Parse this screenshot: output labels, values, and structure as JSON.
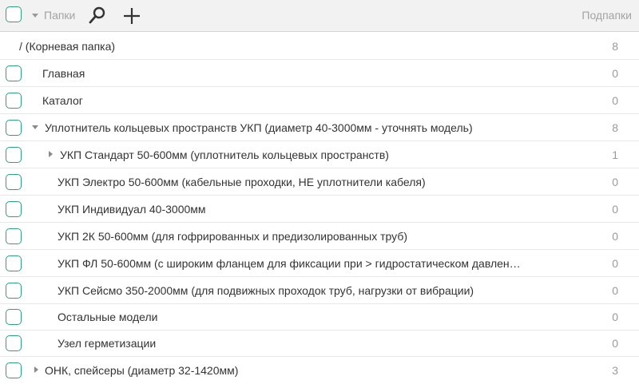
{
  "header": {
    "title": "Папки",
    "subfolders_label": "Подпапки",
    "icons": [
      "search-icon",
      "plus-icon"
    ]
  },
  "colors": {
    "accent": "#2ea37a",
    "header_bg": "#f2f2f2",
    "muted_text": "#a3a3a3"
  },
  "rows": [
    {
      "label": "/ (Корневая папка)",
      "count": "8"
    },
    {
      "label": "Главная",
      "count": "0"
    },
    {
      "label": "Каталог",
      "count": "0"
    },
    {
      "label": "Уплотнитель кольцевых пространств УКП (диаметр 40-3000мм - уточнять модель)",
      "count": "8"
    },
    {
      "label": "УКП Стандарт 50-600мм (уплотнитель кольцевых пространств)",
      "count": "1"
    },
    {
      "label": "УКП Электро 50-600мм (кабельные проходки, НЕ уплотнители кабеля)",
      "count": "0"
    },
    {
      "label": "УКП Индивидуал 40-3000мм",
      "count": "0"
    },
    {
      "label": "УКП 2К  50-600мм (для гофрированных и предизолированных труб)",
      "count": "0"
    },
    {
      "label": "УКП ФЛ 50-600мм (с широким фланцем для фиксации при > гидростатическом давлен…",
      "count": "0"
    },
    {
      "label": "УКП Сейсмо 350-2000мм (для подвижных проходок труб, нагрузки от вибрации)",
      "count": "0"
    },
    {
      "label": "Остальные модели",
      "count": "0"
    },
    {
      "label": "Узел герметизации",
      "count": "0"
    },
    {
      "label": "ОНК, спейсеры (диаметр 32-1420мм)",
      "count": "3"
    }
  ]
}
